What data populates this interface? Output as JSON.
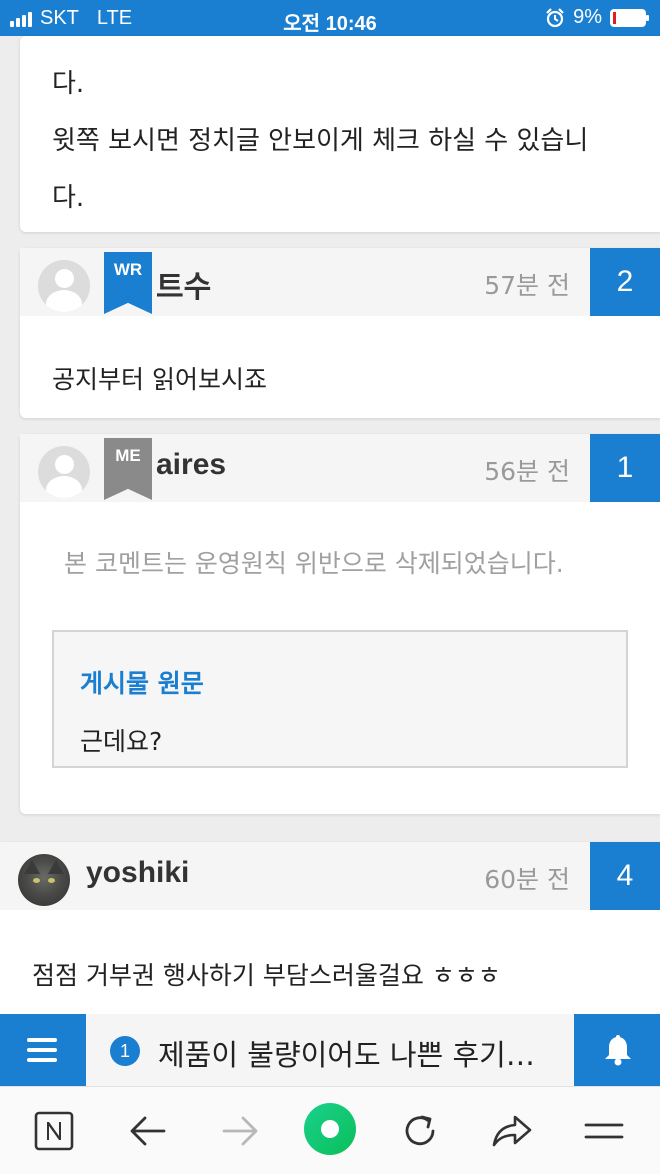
{
  "status_bar": {
    "carrier": "SKT",
    "network": "LTE",
    "time": "오전 10:46",
    "battery_percent": "9%",
    "battery_level": 0.09
  },
  "top_comment": {
    "lines": [
      "다.",
      "윗쪽 보시면 정치글 안보이게  체크 하실 수 있습니",
      "다."
    ]
  },
  "comments": [
    {
      "badge": "WR",
      "username": "트수",
      "time": "57분 전",
      "number": "2",
      "text": "공지부터 읽어보시죠"
    },
    {
      "badge": "ME",
      "username": "aires",
      "time": "56분 전",
      "number": "1",
      "deleted_notice": "본 코멘트는 운영원칙 위반으로 삭제되었습니다.",
      "original_label": "게시물 원문",
      "original_text": "근데요?"
    },
    {
      "username": "yoshiki",
      "time": "60분 전",
      "number": "4",
      "text": "점점 거부권 행사하기 부담스러울걸요 ㅎㅎㅎ"
    }
  ],
  "bottom_bar": {
    "notice_count": "1",
    "notice_text": "제품이 불량이어도 나쁜 후기…"
  },
  "colors": {
    "accent": "#1a7fd0",
    "badge_gray": "#8a8a8a",
    "muted_text": "#9a9a9a"
  }
}
